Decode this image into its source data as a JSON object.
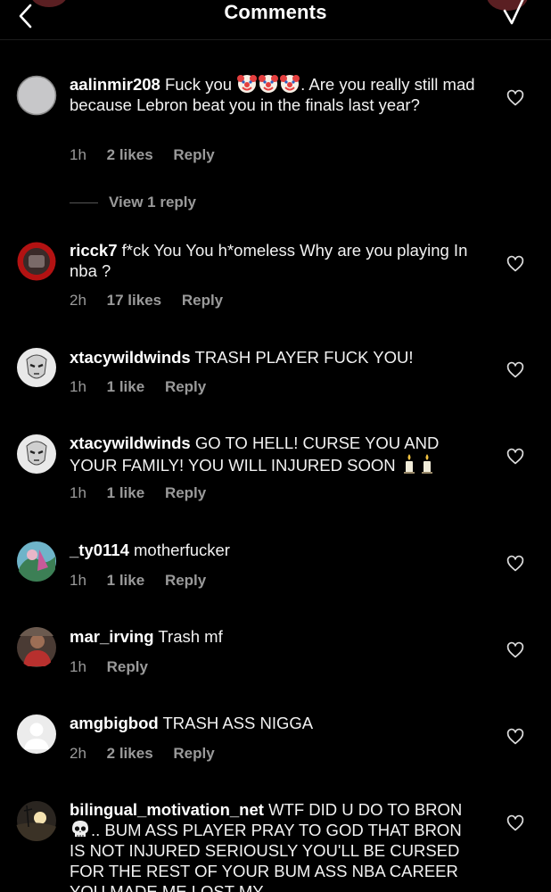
{
  "header": {
    "title": "Comments"
  },
  "comments": [
    {
      "username": "aalinmir208",
      "text_a": "Fuck you",
      "emoji_a": [
        "clown-emoji",
        "clown-emoji",
        "clown-emoji"
      ],
      "text_b": ". Are you really still mad because Lebron beat you in the finals last year?",
      "time": "1h",
      "likes": "2 likes",
      "reply": "Reply",
      "view_replies": "View 1 reply",
      "avatar": "default-avatar-gray"
    },
    {
      "username": "ricck7",
      "text": "f*ck You You h*omeless Why are you playing In nba ?",
      "time": "2h",
      "likes": "17 likes",
      "reply": "Reply",
      "avatar": "red-ring-avatar"
    },
    {
      "username": "xtacywildwinds",
      "text": "TRASH PLAYER FUCK YOU!",
      "time": "1h",
      "likes": "1 like",
      "reply": "Reply",
      "avatar": "white-mask-avatar"
    },
    {
      "username": "xtacywildwinds",
      "text": "GO TO HELL! CURSE YOU AND YOUR FAMILY! YOU WILL INJURED SOON",
      "emoji_after": [
        "candle-emoji",
        "candle-emoji"
      ],
      "time": "1h",
      "likes": "1 like",
      "reply": "Reply",
      "avatar": "white-mask-avatar"
    },
    {
      "username": "_ty0114",
      "text": "motherfucker",
      "time": "1h",
      "likes": "1 like",
      "reply": "Reply",
      "avatar": "colorful-photo-avatar"
    },
    {
      "username": "mar_irving",
      "text": "Trash mf",
      "time": "1h",
      "reply": "Reply",
      "avatar": "person-photo-avatar"
    },
    {
      "username": "amgbigbod",
      "text": "TRASH ASS NIGGA",
      "time": "2h",
      "likes": "2 likes",
      "reply": "Reply",
      "avatar": "default-avatar-light"
    },
    {
      "username": "bilingual_motivation_net",
      "text_a": "WTF DID U DO TO BRON",
      "emoji_a": [
        "skull-emoji"
      ],
      "text_b": ".. BUM ASS PLAYER PRAY TO GOD THAT BRON IS NOT INJURED SERIOUSLY YOU'LL BE CURSED FOR THE REST OF YOUR BUM ASS NBA CAREER YOU MADE ME LOST MY",
      "avatar": "sunset-avatar"
    }
  ],
  "colors": {
    "background": "#000000",
    "text": "#ffffff",
    "meta": "#9a9a9a",
    "header_accent": "#5a1f22"
  }
}
